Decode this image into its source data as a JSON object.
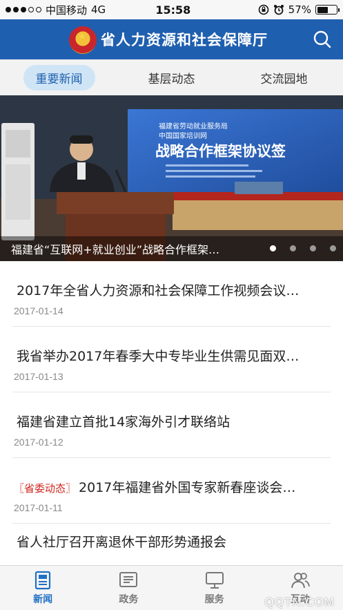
{
  "status_bar": {
    "carrier": "中国移动",
    "network": "4G",
    "time": "15:58",
    "battery": "57%",
    "battery_level": 0.57
  },
  "header": {
    "title": "省人力资源和社会保障厅",
    "brand_color": "#1f5faf"
  },
  "tabs": [
    {
      "label": "重要新闻",
      "active": true
    },
    {
      "label": "基层动态",
      "active": false
    },
    {
      "label": "交流园地",
      "active": false
    }
  ],
  "banner": {
    "caption": "福建省“互联网+就业创业”战略合作框架…",
    "screen_title": "战略合作框架协议签",
    "screen_lines": [
      "福建省劳动就业服务局",
      "中国国家培训网"
    ],
    "page_count": 4,
    "active_page": 1
  },
  "news": [
    {
      "title": "2017年全省人力资源和社会保障工作视频会议…",
      "date": "2017-01-14",
      "tag": ""
    },
    {
      "title": "我省举办2017年春季大中专毕业生供需见面双…",
      "date": "2017-01-13",
      "tag": ""
    },
    {
      "title": "福建省建立首批14家海外引才联络站",
      "date": "2017-01-12",
      "tag": ""
    },
    {
      "title": "2017年福建省外国专家新春座谈会…",
      "date": "2017-01-11",
      "tag": "〖省委动态〗"
    },
    {
      "title": "省人社厅召开离退休干部形势通报会",
      "date": "",
      "tag": ""
    }
  ],
  "bottom_nav": [
    {
      "label": "新闻",
      "icon": "news-icon",
      "active": true
    },
    {
      "label": "政务",
      "icon": "government-affairs-icon",
      "active": false
    },
    {
      "label": "服务",
      "icon": "service-monitor-icon",
      "active": false
    },
    {
      "label": "互动",
      "icon": "people-icon",
      "active": false
    }
  ],
  "watermark": "QQTN.COM"
}
